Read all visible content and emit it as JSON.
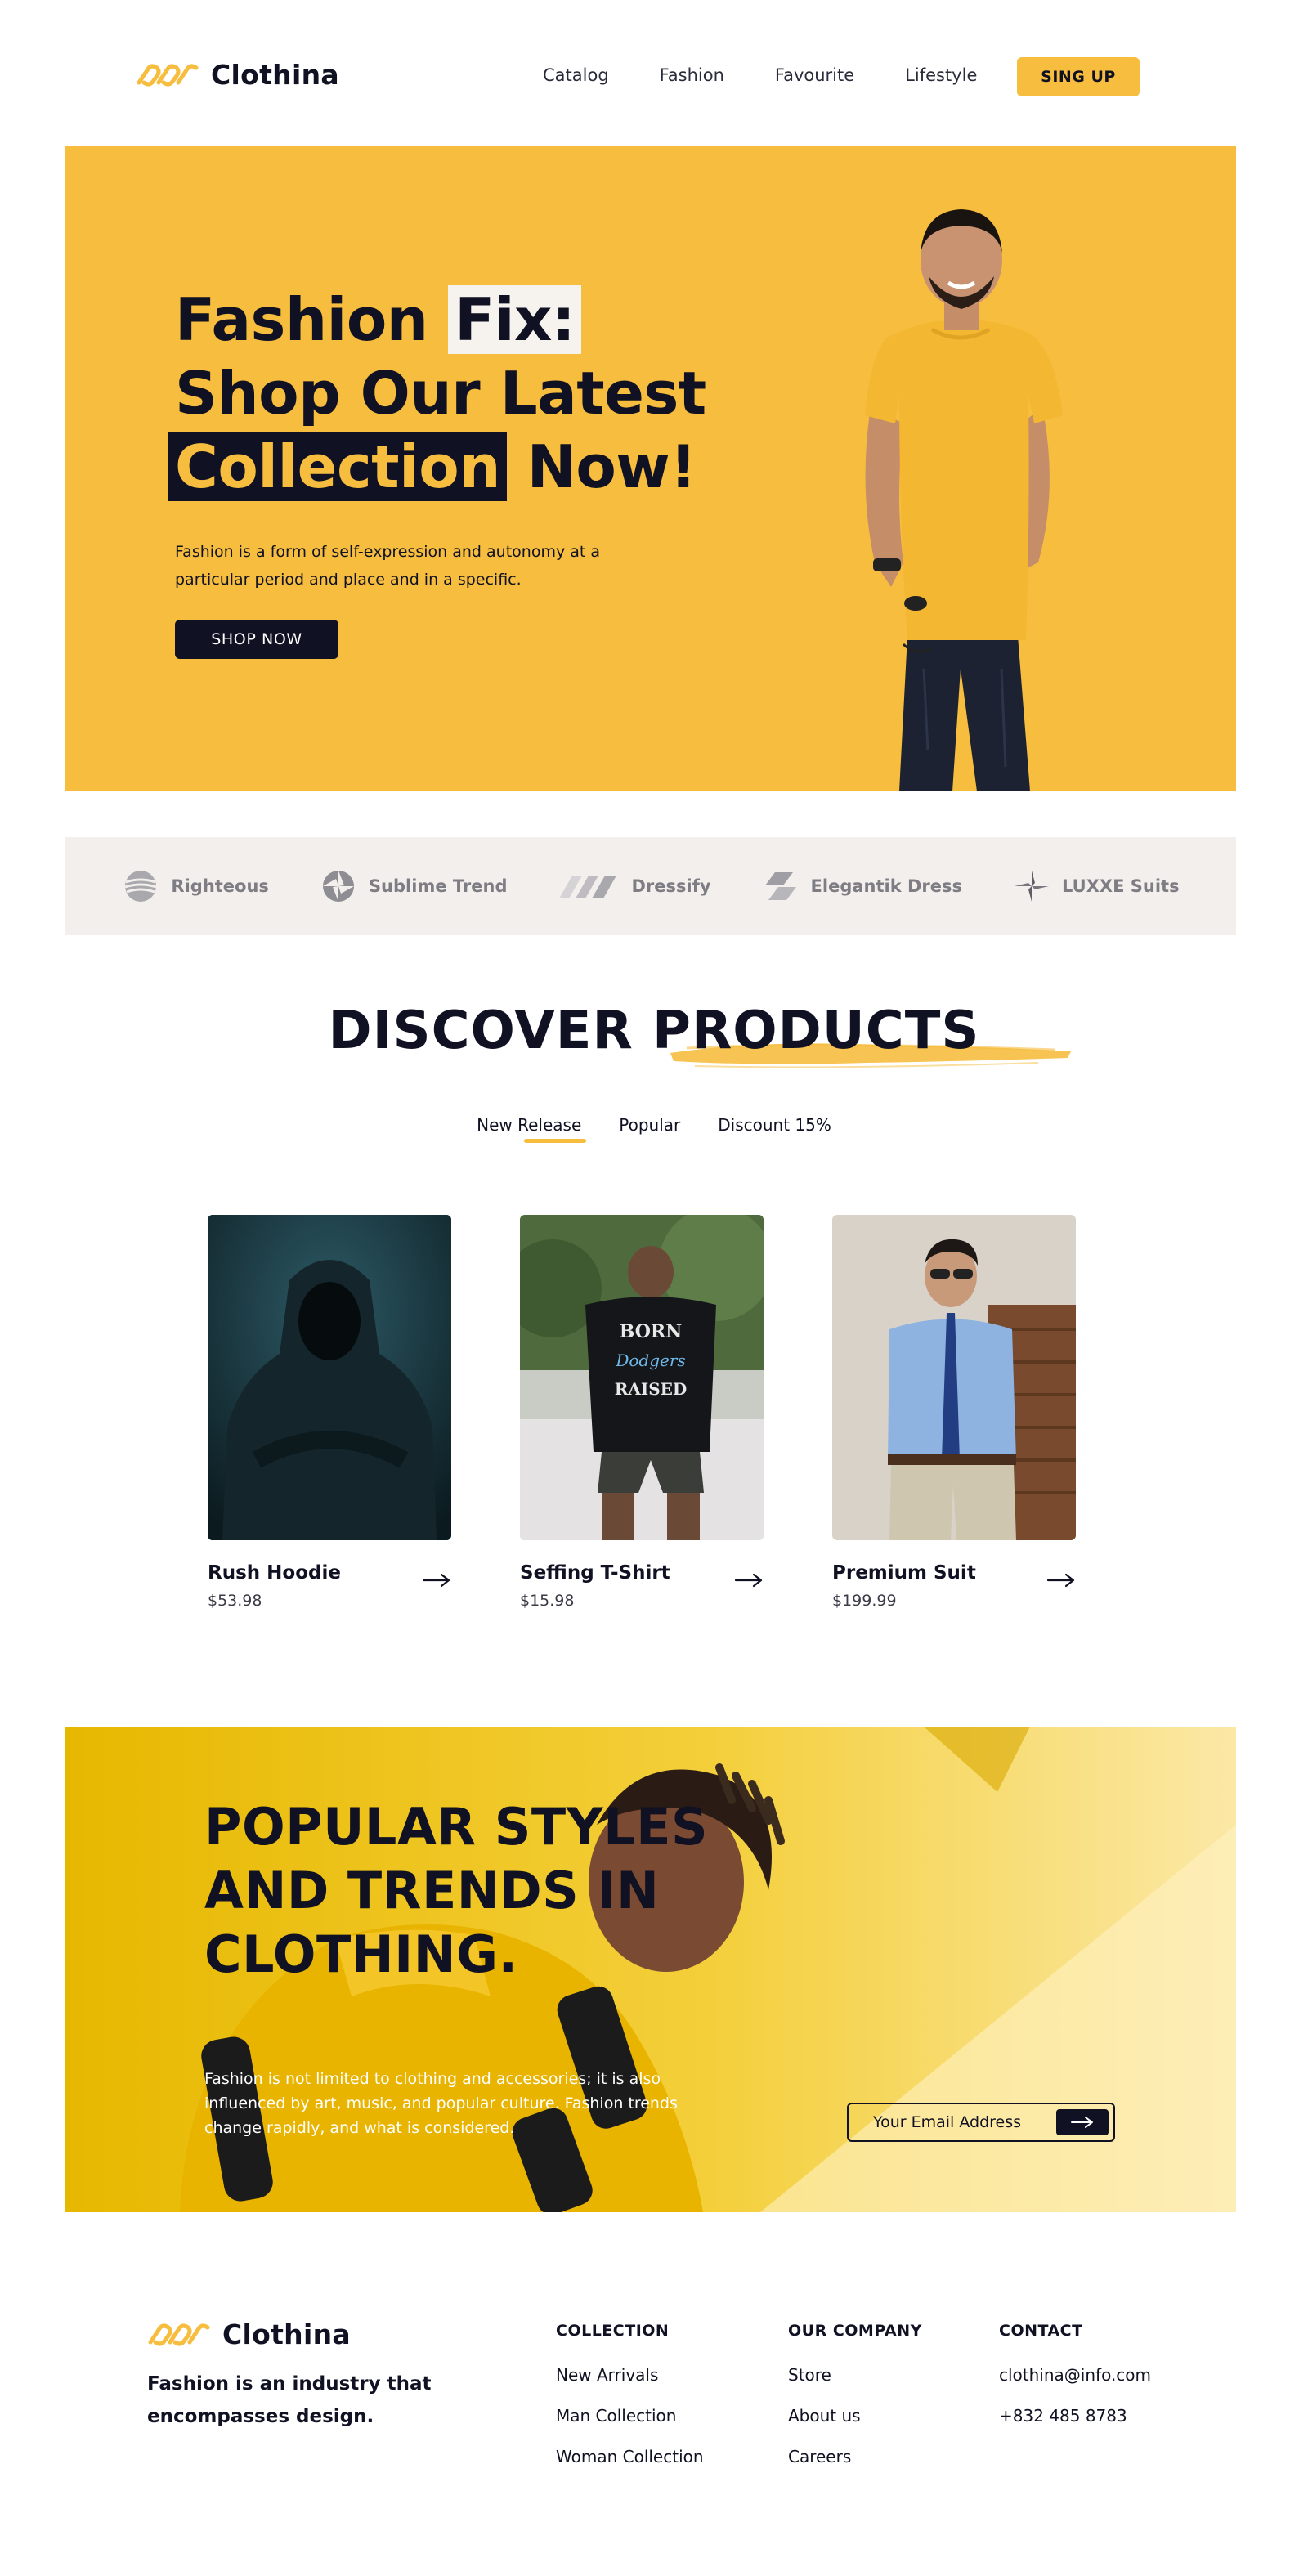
{
  "brand": {
    "name": "Clothina",
    "accent": "#f6bd3f",
    "dark": "#101122"
  },
  "nav": {
    "items": [
      "Catalog",
      "Fashion",
      "Favourite",
      "Lifestyle"
    ],
    "signup_label": "SING UP"
  },
  "hero": {
    "title_part1": "Fashion",
    "title_highlight1": "Fix:",
    "title_line2": "Shop Our Latest",
    "title_highlight2": "Collection",
    "title_part3": "Now!",
    "description": "Fashion is a form of self-expression and autonomy at a particular period and place and in a specific.",
    "cta_label": "SHOP NOW"
  },
  "brands": [
    {
      "name": "Righteous",
      "icon": "sphere-stripes-icon"
    },
    {
      "name": "Sublime Trend",
      "icon": "aperture-icon"
    },
    {
      "name": "Dressify",
      "icon": "parallelogram-stripes-icon"
    },
    {
      "name": "Elegantik Dress",
      "icon": "stacked-parallelogram-icon"
    },
    {
      "name": "LUXXE Suits",
      "icon": "pinwheel-icon"
    }
  ],
  "discover": {
    "title": "DISCOVER PRODUCTS",
    "tabs": [
      "New Release",
      "Popular",
      "Discount 15%"
    ],
    "products": [
      {
        "name": "Rush Hoodie",
        "price": "$53.98"
      },
      {
        "name": "Seffing T-Shirt",
        "price": "$15.98"
      },
      {
        "name": "Premium Suit",
        "price": "$199.99"
      }
    ]
  },
  "popular": {
    "title_lines": [
      "POPULAR STYLES",
      "AND TRENDS IN",
      "CLOTHING."
    ],
    "description": "Fashion is not limited to clothing and accessories; it is also influenced by art, music, and popular culture. Fashion trends change rapidly, and what is considered.",
    "email_placeholder": "Your Email Address"
  },
  "footer": {
    "tagline": "Fashion is an industry that encompasses design.",
    "columns": [
      {
        "title": "COLLECTION",
        "links": [
          "New Arrivals",
          "Man Collection",
          "Woman Collection"
        ]
      },
      {
        "title": "OUR COMPANY",
        "links": [
          "Store",
          "About us",
          "Careers"
        ]
      },
      {
        "title": "CONTACT",
        "links": [
          "clothina@info.com",
          "+832 485 8783"
        ]
      }
    ]
  }
}
